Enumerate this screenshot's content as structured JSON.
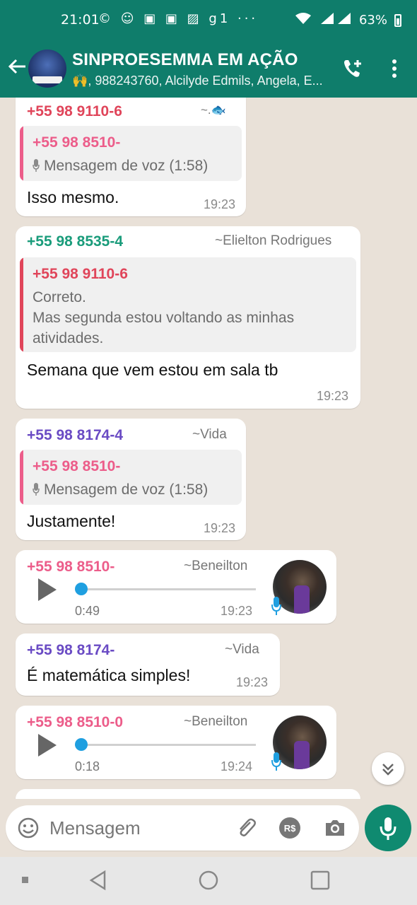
{
  "status_bar": {
    "time": "21:01",
    "left_icons": "© ☺ ▣ ▣ ▨ g1 ···",
    "battery": "63%"
  },
  "header": {
    "title": "SINPROESEMMA EM AÇÃO",
    "subtitle": "🙌, 988243760, Alcilyde Edmils, Angela, E..."
  },
  "messages": [
    {
      "sender": "+55 98 9110-6",
      "alias": "~.🐟",
      "quote_name": "+55 98 8510-",
      "quote_text": "Mensagem de voz (1:58)",
      "text": "Isso mesmo.",
      "time": "19:23"
    },
    {
      "sender": "+55 98 8535-4",
      "alias": "~Elielton Rodrigues",
      "quote_name": "+55 98 9110-6",
      "quote_lines": [
        "Correto.",
        "Mas segunda estou voltando as minhas",
        "atividades."
      ],
      "text": "Semana que vem estou em sala tb",
      "time": "19:23"
    },
    {
      "sender": "+55 98 8174-4",
      "alias": "~Vida",
      "quote_name": "+55 98 8510-",
      "quote_text": "Mensagem de voz (1:58)",
      "text": "Justamente!",
      "time": "19:23"
    },
    {
      "sender": "+55 98 8510-",
      "alias": "~Beneilton",
      "duration": "0:49",
      "time": "19:23",
      "progress": 0
    },
    {
      "sender": "+55 98 8174-",
      "alias": "~Vida",
      "text": "É matemática simples!",
      "time": "19:23"
    },
    {
      "sender": "+55 98 8510-0",
      "alias": "~Beneilton",
      "duration": "0:18",
      "time": "19:24",
      "progress": 0
    }
  ],
  "input": {
    "placeholder": "Mensagem"
  },
  "colors": {
    "header": "#0f7d6b",
    "red_sender": "#e0455a",
    "teal_sender": "#1a9c7b",
    "purple_sender": "#6a4bc4",
    "pink_sender": "#ec5d8a"
  }
}
